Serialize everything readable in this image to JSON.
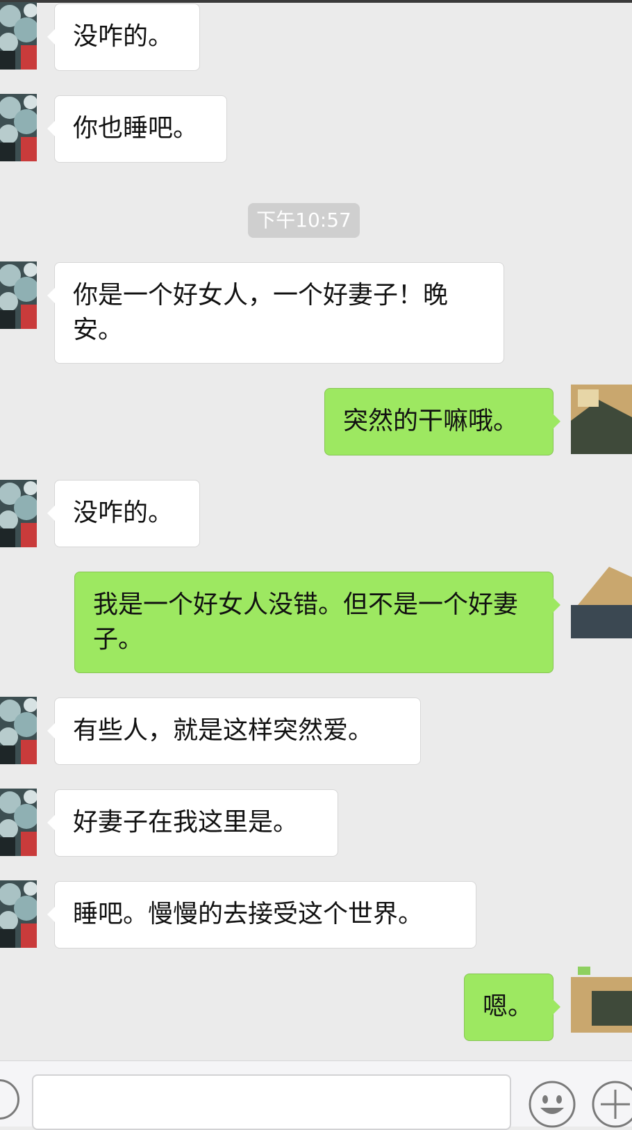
{
  "chat": {
    "messages": [
      {
        "side": "in",
        "text": "没咋的。"
      },
      {
        "side": "in",
        "text": "你也睡吧。"
      },
      {
        "side": "in",
        "text": "你是一个好女人，一个好妻子！晚安。"
      },
      {
        "side": "out",
        "text": "突然的干嘛哦。"
      },
      {
        "side": "in",
        "text": "没咋的。"
      },
      {
        "side": "out",
        "text": "我是一个好女人没错。但不是一个好妻子。"
      },
      {
        "side": "in",
        "text": "有些人，就是这样突然爱。"
      },
      {
        "side": "in",
        "text": "好妻子在我这里是。"
      },
      {
        "side": "in",
        "text": "睡吧。慢慢的去接受这个世界。"
      },
      {
        "side": "out",
        "text": "嗯。"
      }
    ],
    "timestamp": "下午10:57"
  },
  "composer": {
    "input_value": "",
    "icons": [
      "voice-icon",
      "emoji-icon",
      "plus-icon"
    ]
  },
  "colors": {
    "background": "#ebebeb",
    "bubble_in": "#ffffff",
    "bubble_out": "#9de861",
    "timestamp_bg": "#cfcfcf"
  }
}
